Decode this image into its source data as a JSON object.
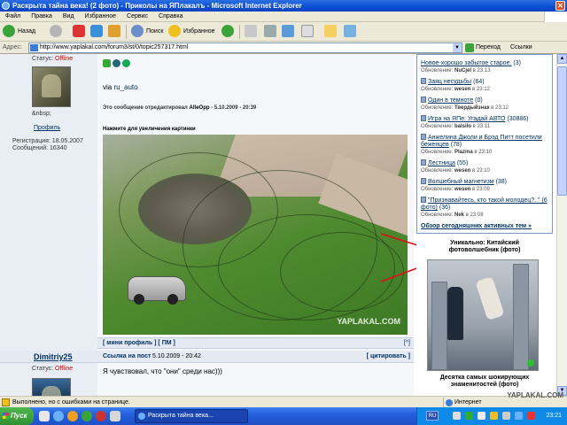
{
  "window": {
    "title": "Раскрыта тайна века! (2 фото) - Приколы на ЯПлакалъ - Microsoft Internet Explorer",
    "close_symbol": "✕"
  },
  "menu": [
    "Файл",
    "Правка",
    "Вид",
    "Избранное",
    "Сервис",
    "Справка"
  ],
  "toolbar": {
    "back": "Назад",
    "search": "Поиск",
    "favorites": "Избранное"
  },
  "address": {
    "label": "Адрес:",
    "url": "http://www.yaplakal.com/forum3/st/0/topic257317.html",
    "go": "Переход",
    "links": "Ссылки"
  },
  "post1": {
    "status_label": "Статус:",
    "status_value": "Offline",
    "nbsp": "&nbsp;",
    "profile_link": "Профиль",
    "registration": "Регистрация: 18.05.2007",
    "messages": "Сообщений: 16340",
    "via_text": "via",
    "via_link": "ru_auto",
    "edit_note_prefix": "Это сообщение отредактировал",
    "edit_author": "AlleOpp",
    "edit_date": "- 5.10.2009 - 20:39",
    "hint": "Нажмите для увеличения картинки",
    "watermark": "YAPLAKAL.COM",
    "footer_links": "[ мини профиль ] [ ПМ ]",
    "up": "[^]"
  },
  "post2": {
    "author": "Dimitriy25",
    "post_link": "Ссылка на пост",
    "date": "5.10.2009 - 20:42",
    "quote": "[ цитировать ]",
    "status_label": "Статус:",
    "status_value": "Offline",
    "text": "Я чувствовал, что \"они\" среди нас)))"
  },
  "topics": [
    {
      "title": "Новое-хорошо забытое старое.",
      "count": "(3)",
      "upd_label": "Обновление:",
      "upd_user": "NuCjel",
      "upd_time": "в 23:13"
    },
    {
      "title": "Заяц несудьбы",
      "count": "(64)",
      "upd_label": "Обновление:",
      "upd_user": "wesen",
      "upd_time": "в 23:12"
    },
    {
      "title": "Один в темноте",
      "count": "(0)",
      "upd_label": "Обновление:",
      "upd_user": "Твердыйзнак",
      "upd_time": "в 23:12"
    },
    {
      "title": "Игра на ЯПе: Угадай АВТО",
      "count": "(30886)",
      "upd_label": "Обновление:",
      "upd_user": "balsilo",
      "upd_time": "в 23:11"
    },
    {
      "title": "Анжелина Джоли и Брэд Питт посетили беженцев",
      "count": "(78)",
      "upd_label": "Обновление:",
      "upd_user": "Plazma",
      "upd_time": "в 23:10"
    },
    {
      "title": "Лестница",
      "count": "(55)",
      "upd_label": "Обновление:",
      "upd_user": "wesen",
      "upd_time": "в 23:10"
    },
    {
      "title": "Волшебный магнетизм",
      "count": "(38)",
      "upd_label": "Обновление:",
      "upd_user": "wesen",
      "upd_time": "в 23:09"
    },
    {
      "title": "\"Признавайтесь, кто такой молодец?..\" (6 фото)",
      "count": "(36)",
      "upd_label": "Обновление:",
      "upd_user": "Nek",
      "upd_time": "в 23:08"
    }
  ],
  "topics_more": "Обзор сегодняшних активных тем »",
  "promo1_title": "Уникально: Китайский фотоволшебник (фото)",
  "promo2_title": "Десятка самых шокирующих знаменитостей (фото)",
  "statusbar": {
    "text": "Выполнено, но с ошибками на странице.",
    "zone": "Интернет",
    "watermark": "YAPLAKAL.COM"
  },
  "taskbar": {
    "start": "Пуск",
    "item": "Раскрыта тайна века...",
    "lang": "RU",
    "clock": "23:21"
  }
}
